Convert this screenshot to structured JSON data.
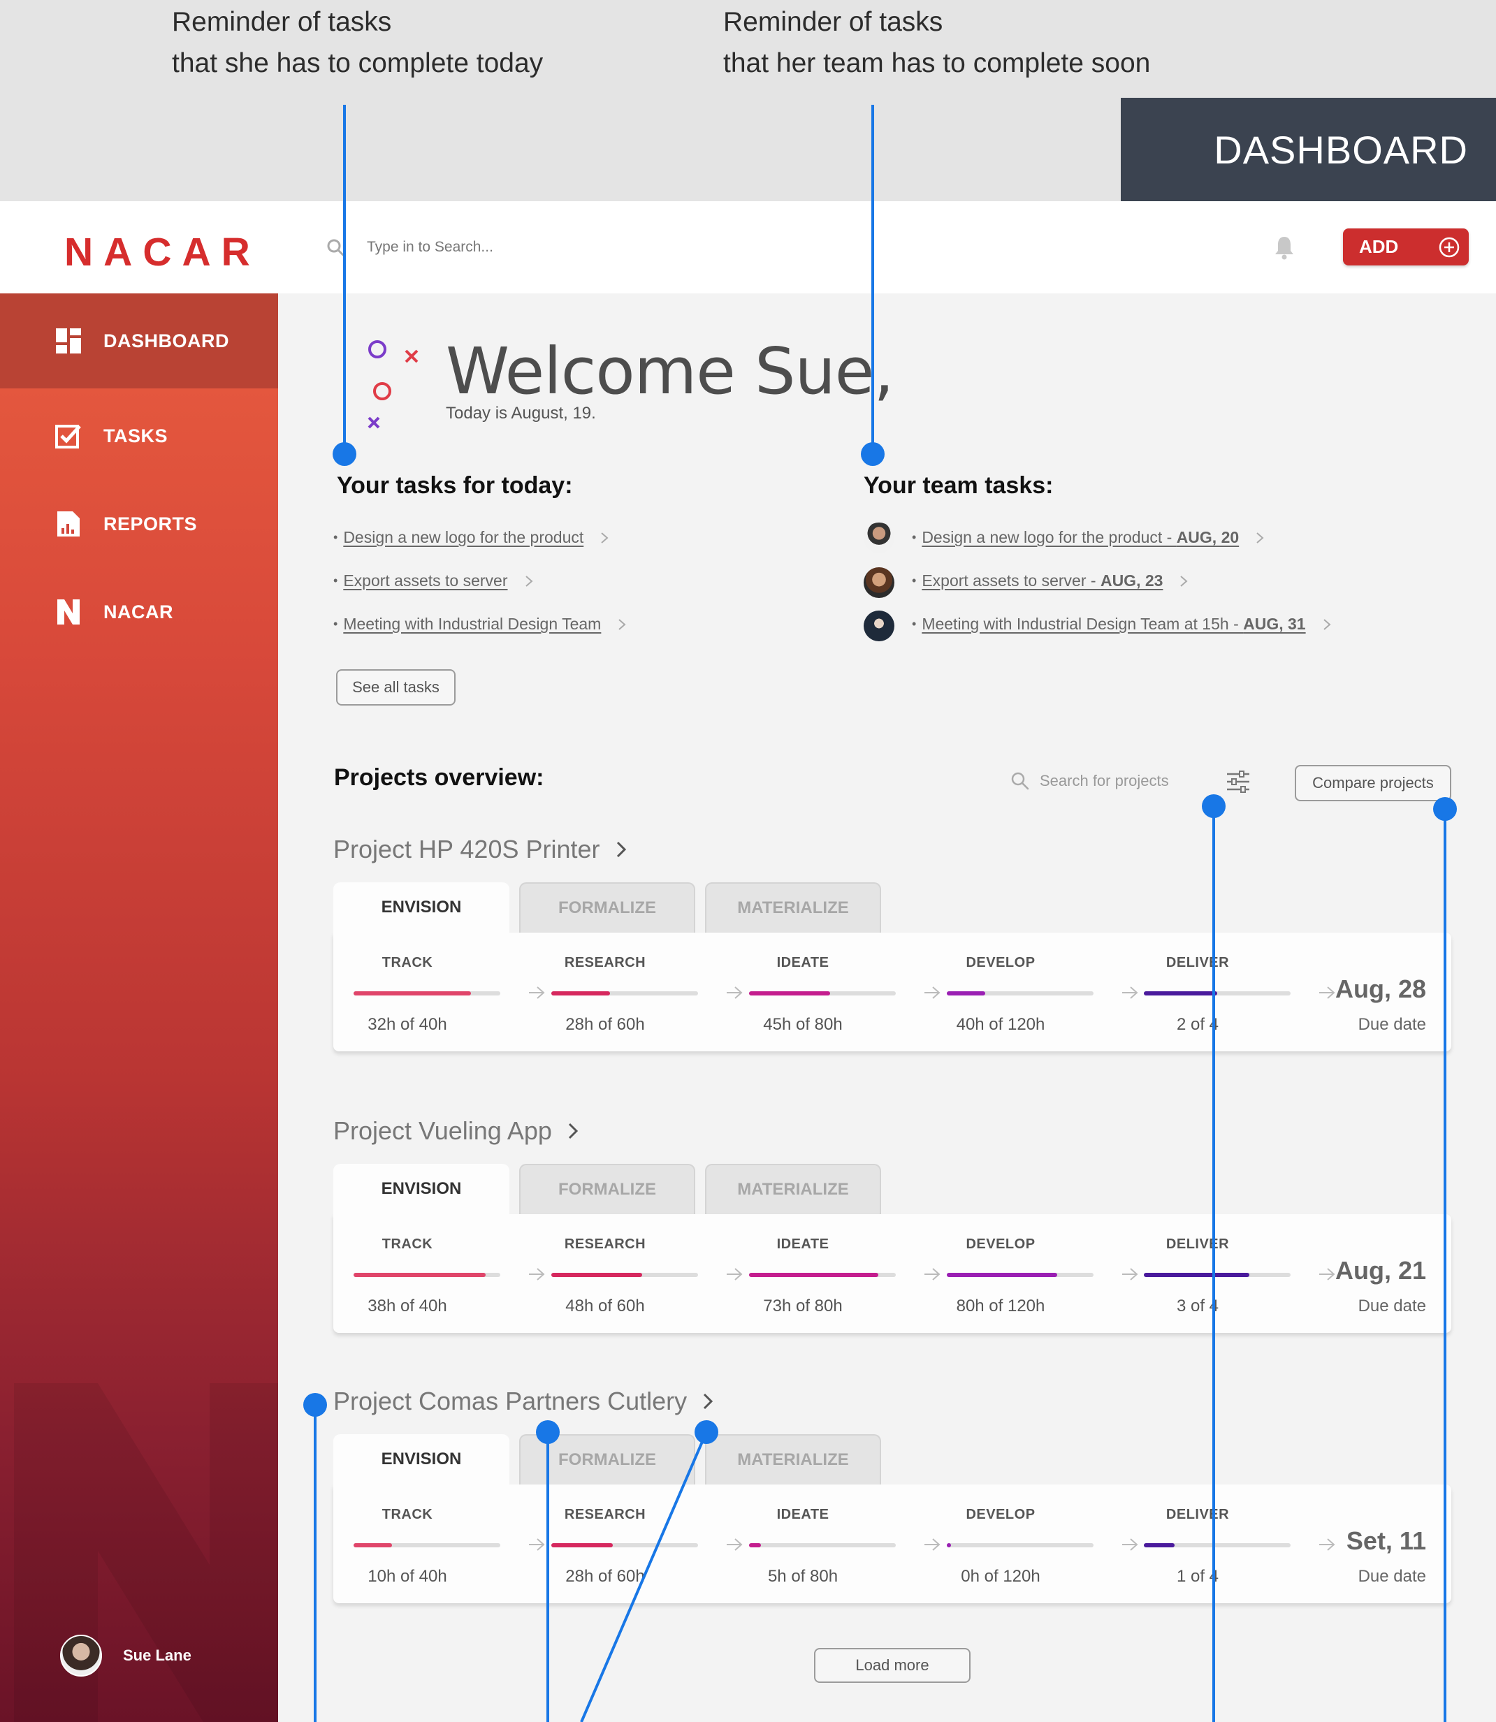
{
  "annotations": {
    "left_line1": "Reminder of tasks",
    "left_line2": "that she has to complete today",
    "right_line1": "Reminder of tasks",
    "right_line2": "that her team has to complete soon",
    "tag": "DASHBOARD"
  },
  "header": {
    "logo": "NACAR",
    "search_placeholder": "Type in to Search...",
    "add_label": "ADD"
  },
  "sidebar": {
    "items": [
      {
        "label": "DASHBOARD",
        "icon": "dashboard-icon",
        "active": true
      },
      {
        "label": "TASKS",
        "icon": "tasks-icon",
        "active": false
      },
      {
        "label": "REPORTS",
        "icon": "reports-icon",
        "active": false
      },
      {
        "label": "NACAR",
        "icon": "nacar-n-icon",
        "active": false
      }
    ],
    "user_name": "Sue Lane"
  },
  "welcome": {
    "title": "Welcome Sue,",
    "subtitle": "Today is August, 19."
  },
  "today_tasks": {
    "heading": "Your tasks for today:",
    "items": [
      "Design a new logo for the product",
      "Export assets to server",
      "Meeting with Industrial Design Team"
    ],
    "see_all": "See all tasks"
  },
  "team_tasks": {
    "heading": "Your team tasks:",
    "items": [
      {
        "text": "Design a new logo for the product - ",
        "date": "AUG, 20"
      },
      {
        "text": "Export assets to server - ",
        "date": "AUG, 23"
      },
      {
        "text": "Meeting with Industrial Design Team at 15h - ",
        "date": "AUG, 31"
      }
    ]
  },
  "projects": {
    "heading": "Projects overview:",
    "search_placeholder": "Search for projects",
    "compare_label": "Compare projects",
    "tabs": [
      "ENVISION",
      "FORMALIZE",
      "MATERIALIZE"
    ],
    "stage_names": [
      "TRACK",
      "RESEARCH",
      "IDEATE",
      "DEVELOP",
      "DELIVER"
    ],
    "due_label": "Due date",
    "stage_colors": [
      "#e0456a",
      "#d6285e",
      "#c41d8e",
      "#9a1fb3",
      "#4a1a9c"
    ],
    "list": [
      {
        "name": "Project HP 420S Printer",
        "values": [
          "32h of 40h",
          "28h of 60h",
          "45h of 80h",
          "40h of 120h",
          "2 of 4"
        ],
        "progress": [
          0.8,
          0.4,
          0.55,
          0.26,
          0.5
        ],
        "due": "Aug, 28"
      },
      {
        "name": "Project Vueling App",
        "values": [
          "38h of 40h",
          "48h of 60h",
          "73h of 80h",
          "80h of 120h",
          "3 of 4"
        ],
        "progress": [
          0.9,
          0.62,
          0.88,
          0.75,
          0.72
        ],
        "due": "Aug, 21"
      },
      {
        "name": "Project Comas Partners Cutlery",
        "values": [
          "10h of 40h",
          "28h of 60h",
          "5h of 80h",
          "0h of 120h",
          "1 of 4"
        ],
        "progress": [
          0.26,
          0.42,
          0.08,
          0.03,
          0.21
        ],
        "due": "Set, 11"
      }
    ],
    "load_more": "Load more"
  }
}
